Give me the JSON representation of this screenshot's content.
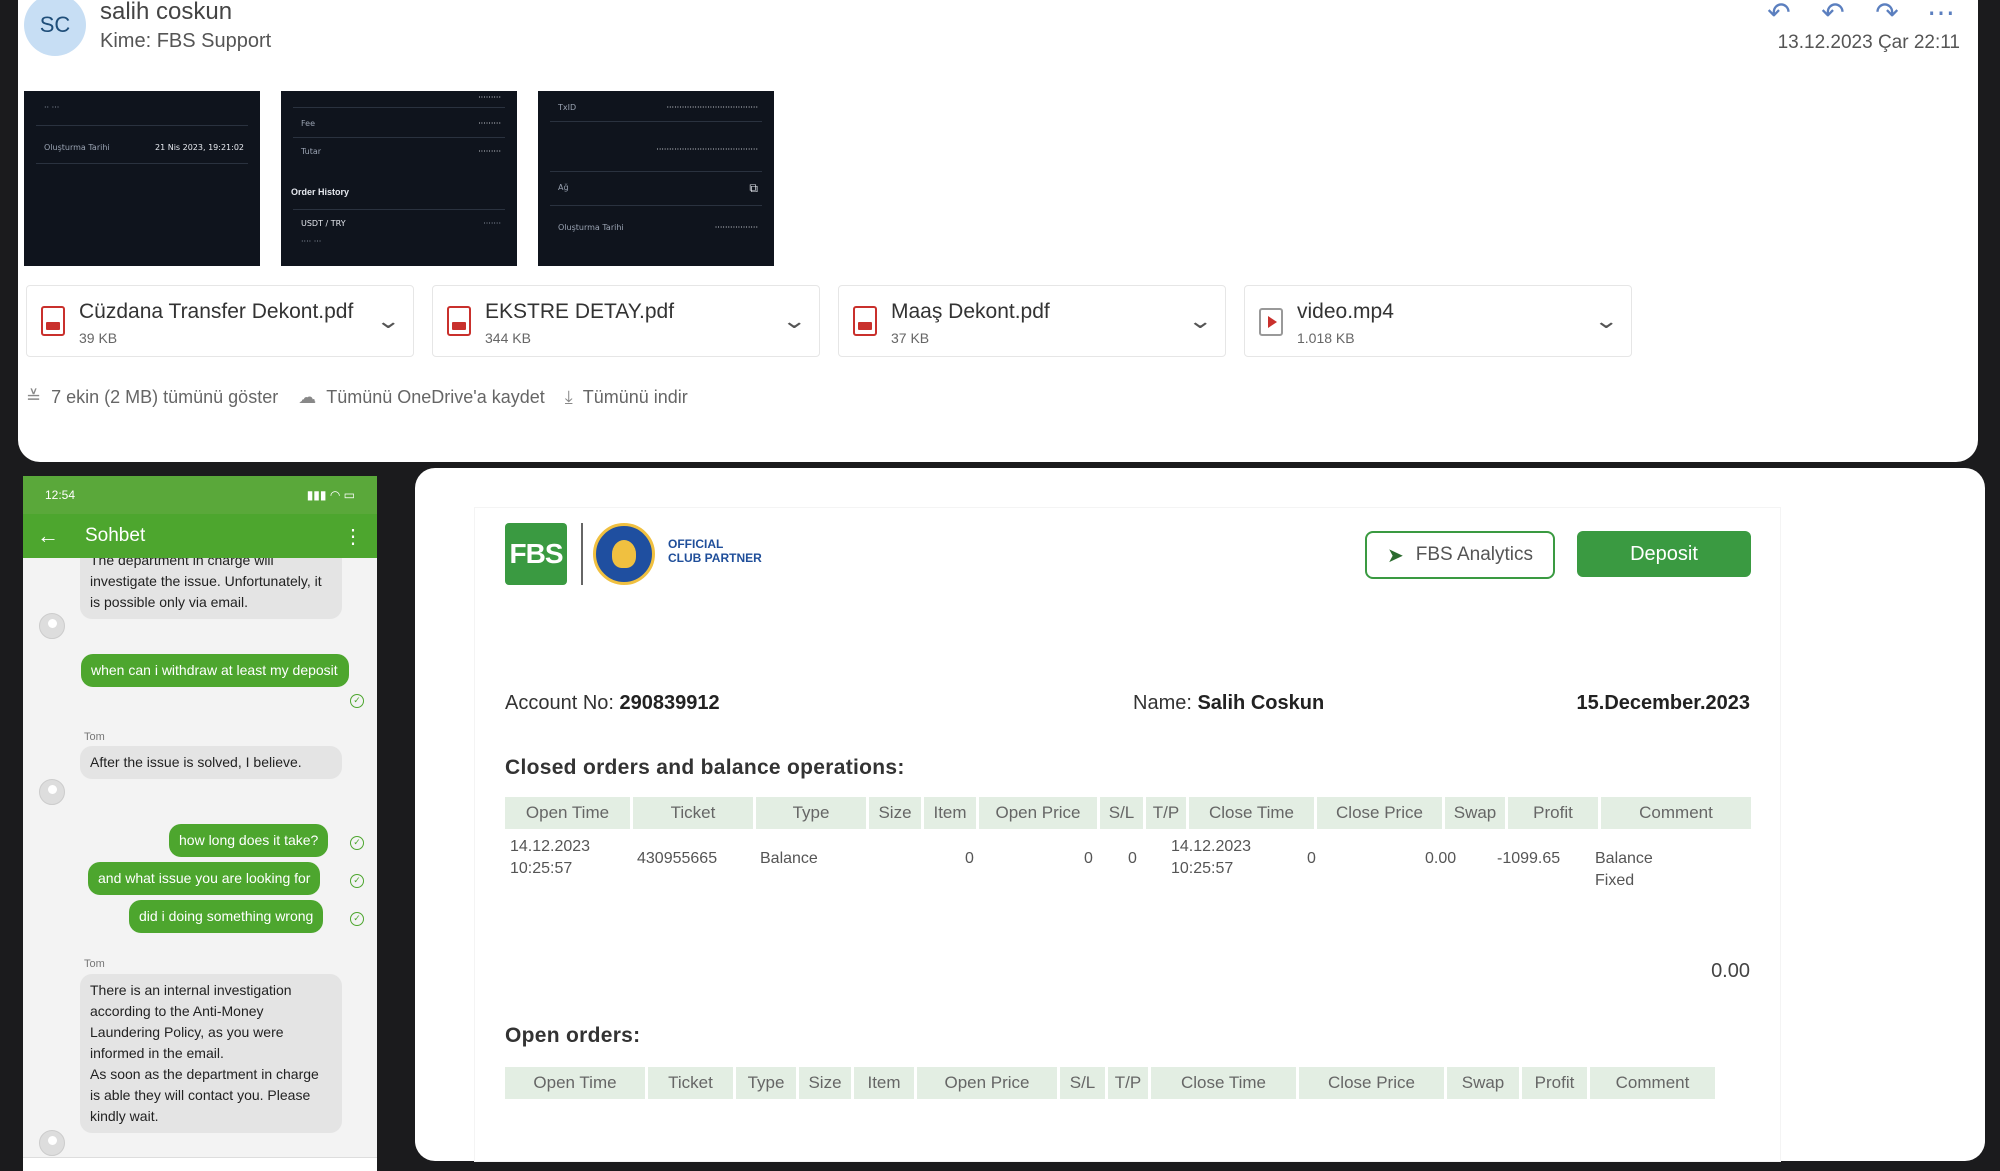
{
  "email": {
    "avatar_initials": "SC",
    "sender": "salih coskun",
    "to_label": "Kime:",
    "to": "FBS Support",
    "date": "13.12.2023 Çar 22:11",
    "thumbnails": [
      {
        "label": "Oluşturma Tarihi",
        "value": "21 Nis 2023, 19:21:02"
      },
      {
        "label": "Order History",
        "rows": [
          "Fee",
          "Tutar",
          "USDT / TRY"
        ]
      },
      {
        "label": "TxID",
        "rows": [
          "Ağ",
          "Oluşturma Tarihi"
        ]
      }
    ],
    "attachments": [
      {
        "name": "Cüzdana Transfer Dekont.pdf",
        "size": "39 KB",
        "kind": "pdf"
      },
      {
        "name": "EKSTRE DETAY.pdf",
        "size": "344 KB",
        "kind": "pdf"
      },
      {
        "name": "Maaş Dekont.pdf",
        "size": "37 KB",
        "kind": "pdf"
      },
      {
        "name": "video.mp4",
        "size": "1.018 KB",
        "kind": "video"
      }
    ],
    "footer": {
      "show_all": "7 ekin (2 MB) tümünü göster",
      "save_onedrive": "Tümünü OneDrive'a kaydet",
      "download_all": "Tümünü indir"
    }
  },
  "phone": {
    "time": "12:54",
    "title": "Sohbet",
    "messages": [
      {
        "from": "agent",
        "text": "The department in charge will investigate the issue. Unfortunately, it is possible only via email."
      },
      {
        "from": "user",
        "text": "when can i withdraw at least my deposit"
      },
      {
        "from": "agent",
        "sender": "Tom",
        "text": "After the issue is solved, I believe."
      },
      {
        "from": "user",
        "text": "how long does it take?"
      },
      {
        "from": "user",
        "text": "and what issue you are looking for"
      },
      {
        "from": "user",
        "text": "did i doing something wrong"
      },
      {
        "from": "agent",
        "sender": "Tom",
        "text": "There is an internal investigation according to the Anti-Money Laundering Policy, as you were informed in the email.\nAs soon as the department in charge is able they will contact you. Please kindly wait."
      }
    ]
  },
  "statement": {
    "partner_line1": "OFFICIAL",
    "partner_line2": "CLUB PARTNER",
    "logo_text": "FBS",
    "analytics_button": "FBS Analytics",
    "deposit_button": "Deposit",
    "account_label": "Account No:",
    "account_no": "290839912",
    "name_label": "Name:",
    "name": "Salih Coskun",
    "date": "15.December.2023",
    "closed_title": "Closed orders and balance operations:",
    "closed_headers": [
      "Open Time",
      "Ticket",
      "Type",
      "Size",
      "Item",
      "Open Price",
      "S/L",
      "T/P",
      "Close Time",
      "Close Price",
      "Swap",
      "Profit",
      "Comment"
    ],
    "closed_rows": [
      {
        "open_time": "14.12.2023 10:25:57",
        "ticket": "430955665",
        "type": "Balance",
        "size": "",
        "item": "",
        "open_price": "0",
        "sl": "0",
        "tp": "0",
        "close_time": "14.12.2023 10:25:57",
        "close_price": "0",
        "swap": "0.00",
        "profit": "-1099.65",
        "comment": "Balance Fixed"
      }
    ],
    "closed_total": "0.00",
    "open_title": "Open orders:",
    "open_headers": [
      "Open Time",
      "Ticket",
      "Type",
      "Size",
      "Item",
      "Open Price",
      "S/L",
      "T/P",
      "Close Time",
      "Close Price",
      "Swap",
      "Profit",
      "Comment"
    ]
  }
}
